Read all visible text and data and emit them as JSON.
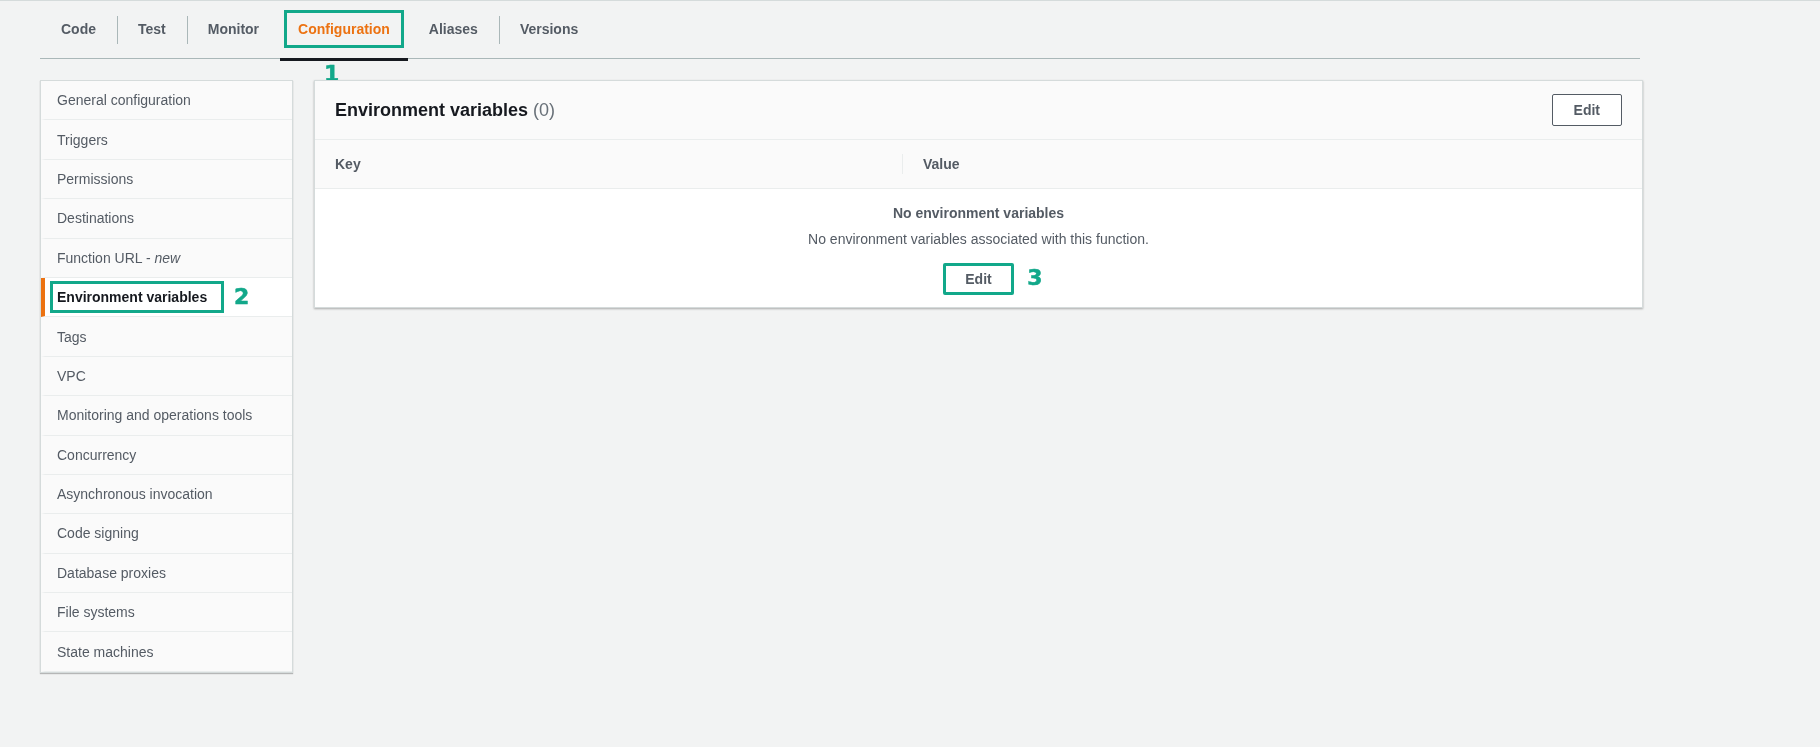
{
  "tabs": [
    {
      "label": "Code",
      "selected": false,
      "highlighted": false
    },
    {
      "label": "Test",
      "selected": false,
      "highlighted": false
    },
    {
      "label": "Monitor",
      "selected": false,
      "highlighted": false
    },
    {
      "label": "Configuration",
      "selected": true,
      "highlighted": true,
      "callout": "1"
    },
    {
      "label": "Aliases",
      "selected": false,
      "highlighted": false
    },
    {
      "label": "Versions",
      "selected": false,
      "highlighted": false
    }
  ],
  "sidebar": {
    "items": [
      {
        "label": "General configuration",
        "selected": false
      },
      {
        "label": "Triggers",
        "selected": false
      },
      {
        "label": "Permissions",
        "selected": false
      },
      {
        "label": "Destinations",
        "selected": false
      },
      {
        "label": "Function URL - *new*",
        "selected": false
      },
      {
        "label": "Environment variables",
        "selected": true,
        "highlighted": true,
        "callout": "2"
      },
      {
        "label": "Tags",
        "selected": false
      },
      {
        "label": "VPC",
        "selected": false
      },
      {
        "label": "Monitoring and operations tools",
        "selected": false
      },
      {
        "label": "Concurrency",
        "selected": false
      },
      {
        "label": "Asynchronous invocation",
        "selected": false
      },
      {
        "label": "Code signing",
        "selected": false
      },
      {
        "label": "Database proxies",
        "selected": false
      },
      {
        "label": "File systems",
        "selected": false
      },
      {
        "label": "State machines",
        "selected": false
      }
    ]
  },
  "panel": {
    "title": "Environment variables",
    "count": "(0)",
    "edit_button": "Edit",
    "table": {
      "columns": [
        "Key",
        "Value"
      ]
    },
    "empty_state": {
      "title": "No environment variables",
      "message": "No environment variables associated with this function.",
      "button": "Edit",
      "highlighted": true,
      "callout": "3"
    }
  }
}
